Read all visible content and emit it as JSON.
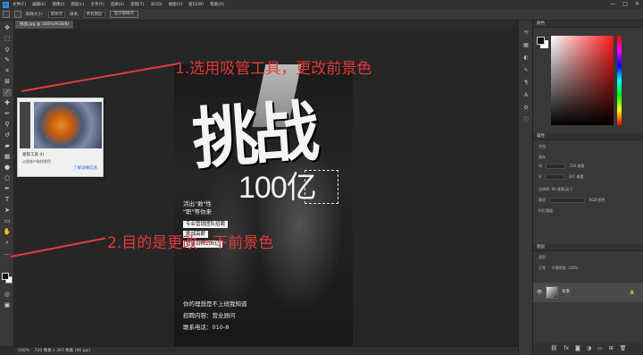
{
  "app": {
    "menu": [
      "文件(F)",
      "编辑(E)",
      "图像(I)",
      "图层(L)",
      "文字(Y)",
      "选择(S)",
      "滤镜(T)",
      "3D(D)",
      "视图(V)",
      "窗口(W)",
      "帮助(H)"
    ],
    "window_controls": [
      "—",
      "□",
      "✕"
    ]
  },
  "options_bar": {
    "sample_size_label": "取样大小:",
    "sample_size_value": "取样点",
    "sample_label": "样本:",
    "sample_value": "所有图层",
    "show_ring_button": "显示取样环"
  },
  "document": {
    "tab_label": "挑战.jpg @ 100%(RGB/8)",
    "zoom": "100%",
    "doc_info": "720 像素 x 397 像素 (96 ppi)"
  },
  "poster": {
    "title": "挑战",
    "number": "100亿",
    "slogan": "活出\"敢\"性\n\"职\"等你来",
    "tags": [
      "专业营销团队招聘",
      "挑战高薪",
      "销售目标100亿"
    ],
    "info": "你的理想是不上班我知道\n招聘内容：营业顾问\n联系电话：010-8"
  },
  "annotations": {
    "step1": "1.选用吸管工具，更改前景色",
    "step2": "2.目的是更改一下前景色"
  },
  "tooltip": {
    "title": "吸管工具 (I)",
    "desc": "从图像中取样颜色",
    "link": "了解详细信息"
  },
  "panels": {
    "color_tab": "颜色",
    "properties_tab": "属性",
    "properties_doc_label": "文档",
    "canvas_label": "画布",
    "w_label": "W",
    "h_label": "H",
    "w_value": "720 像素",
    "h_value": "397 像素",
    "resolution_label": "分辨率: 96 像素/英寸",
    "mode_label": "模式",
    "mode_value": "RGB 颜色",
    "depth_value": "8位/通道",
    "layers_tab": "图层",
    "layer_kind": "类型",
    "layer_blend": "正常",
    "layer_opacity": "不透明度: 100%",
    "layer_name": "背景"
  },
  "colors": {
    "annotation": "#e23a3a",
    "accent": "#2f8ef0"
  }
}
